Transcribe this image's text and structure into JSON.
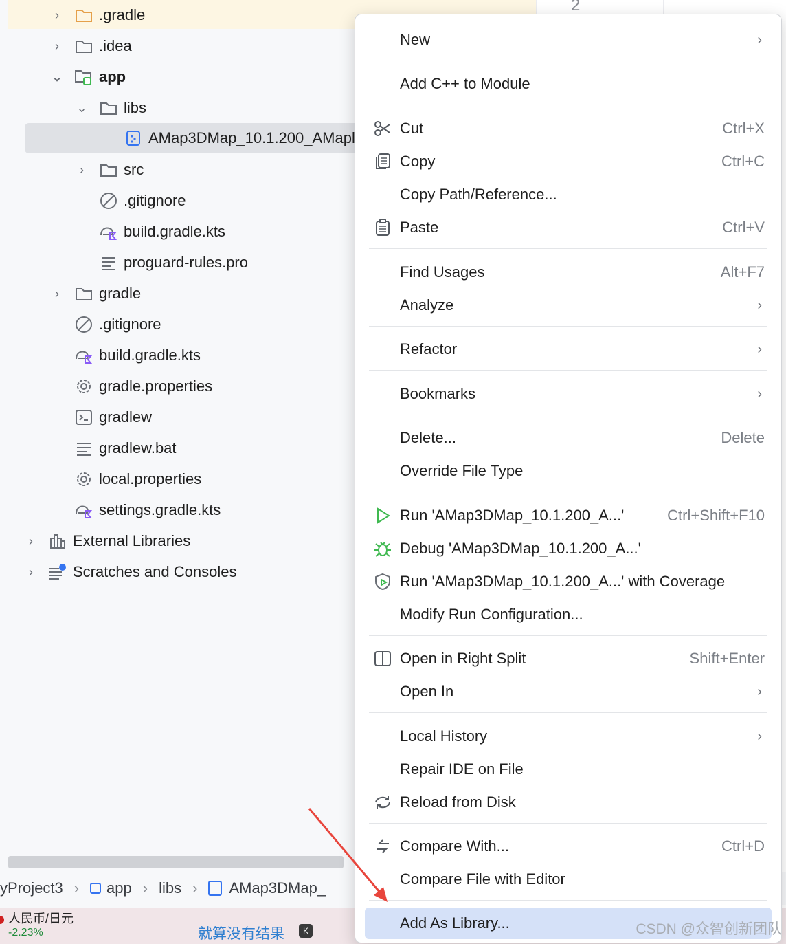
{
  "tree": {
    "items": [
      {
        "label": ".gradle",
        "chev": "›",
        "icon": "folder-orange"
      },
      {
        "label": ".idea",
        "chev": "›",
        "icon": "folder"
      },
      {
        "label": "app",
        "chev": "⌄",
        "icon": "module-folder"
      },
      {
        "label": "libs",
        "chev": "⌄",
        "icon": "folder"
      },
      {
        "label": "AMap3DMap_10.1.200_AMapl",
        "chev": "",
        "icon": "jar-file"
      },
      {
        "label": "src",
        "chev": "›",
        "icon": "folder"
      },
      {
        "label": ".gitignore",
        "chev": "",
        "icon": "ignore-file"
      },
      {
        "label": "build.gradle.kts",
        "chev": "",
        "icon": "gradle-kotlin"
      },
      {
        "label": "proguard-rules.pro",
        "chev": "",
        "icon": "text-file"
      },
      {
        "label": "gradle",
        "chev": "›",
        "icon": "folder"
      },
      {
        "label": ".gitignore",
        "chev": "",
        "icon": "ignore-file"
      },
      {
        "label": "build.gradle.kts",
        "chev": "",
        "icon": "gradle-kotlin"
      },
      {
        "label": "gradle.properties",
        "chev": "",
        "icon": "settings-gear"
      },
      {
        "label": "gradlew",
        "chev": "",
        "icon": "terminal"
      },
      {
        "label": "gradlew.bat",
        "chev": "",
        "icon": "text-file"
      },
      {
        "label": "local.properties",
        "chev": "",
        "icon": "settings-gear"
      },
      {
        "label": "settings.gradle.kts",
        "chev": "",
        "icon": "gradle-kotlin"
      },
      {
        "label": "External Libraries",
        "chev": "›",
        "icon": "library"
      },
      {
        "label": "Scratches and Consoles",
        "chev": "›",
        "icon": "scratches"
      }
    ]
  },
  "editor": {
    "line_number": "2"
  },
  "breadcrumb": {
    "items": [
      "yProject3",
      "app",
      "libs",
      "AMap3DMap_"
    ]
  },
  "menu": {
    "items": [
      {
        "label": "New",
        "shortcut": "",
        "submenu": true,
        "icon": ""
      },
      {
        "label": "Add C++ to Module",
        "shortcut": "",
        "submenu": false,
        "icon": ""
      },
      {
        "label": "Cut",
        "shortcut": "Ctrl+X",
        "submenu": false,
        "icon": "scissors-icon"
      },
      {
        "label": "Copy",
        "shortcut": "Ctrl+C",
        "submenu": false,
        "icon": "copy-icon"
      },
      {
        "label": "Copy Path/Reference...",
        "shortcut": "",
        "submenu": false,
        "icon": ""
      },
      {
        "label": "Paste",
        "shortcut": "Ctrl+V",
        "submenu": false,
        "icon": "clipboard-icon"
      },
      {
        "label": "Find Usages",
        "shortcut": "Alt+F7",
        "submenu": false,
        "icon": ""
      },
      {
        "label": "Analyze",
        "shortcut": "",
        "submenu": true,
        "icon": ""
      },
      {
        "label": "Refactor",
        "shortcut": "",
        "submenu": true,
        "icon": ""
      },
      {
        "label": "Bookmarks",
        "shortcut": "",
        "submenu": true,
        "icon": ""
      },
      {
        "label": "Delete...",
        "shortcut": "Delete",
        "submenu": false,
        "icon": ""
      },
      {
        "label": "Override File Type",
        "shortcut": "",
        "submenu": false,
        "icon": ""
      },
      {
        "label": "Run 'AMap3DMap_10.1.200_A...'",
        "shortcut": "Ctrl+Shift+F10",
        "submenu": false,
        "icon": "run-icon"
      },
      {
        "label": "Debug 'AMap3DMap_10.1.200_A...'",
        "shortcut": "",
        "submenu": false,
        "icon": "bug-icon"
      },
      {
        "label": "Run 'AMap3DMap_10.1.200_A...' with Coverage",
        "shortcut": "",
        "submenu": false,
        "icon": "coverage-icon"
      },
      {
        "label": "Modify Run Configuration...",
        "shortcut": "",
        "submenu": false,
        "icon": ""
      },
      {
        "label": "Open in Right Split",
        "shortcut": "Shift+Enter",
        "submenu": false,
        "icon": "split-icon"
      },
      {
        "label": "Open In",
        "shortcut": "",
        "submenu": true,
        "icon": ""
      },
      {
        "label": "Local History",
        "shortcut": "",
        "submenu": true,
        "icon": ""
      },
      {
        "label": "Repair IDE on File",
        "shortcut": "",
        "submenu": false,
        "icon": ""
      },
      {
        "label": "Reload from Disk",
        "shortcut": "",
        "submenu": false,
        "icon": "reload-icon"
      },
      {
        "label": "Compare With...",
        "shortcut": "Ctrl+D",
        "submenu": false,
        "icon": "compare-icon"
      },
      {
        "label": "Compare File with Editor",
        "shortcut": "",
        "submenu": false,
        "icon": ""
      },
      {
        "label": "Add As Library...",
        "shortcut": "",
        "submenu": false,
        "icon": ""
      }
    ],
    "highlighted_item": "Add As Library...",
    "colors": {
      "highlight": "#d5e1f8",
      "arrow": "#e8453c"
    }
  },
  "taskbar": {
    "currency": "人民币/日元",
    "change": "-2.23%",
    "song": "就算没有结果",
    "k_badge": "K"
  },
  "watermark": "CSDN @众智创新团队"
}
